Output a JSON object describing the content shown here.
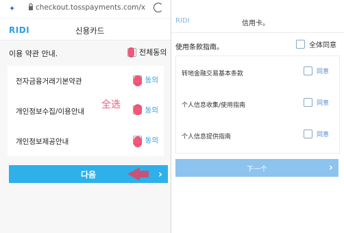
{
  "left": {
    "browser": {
      "url": "checkout.tosspayments.com/x"
    },
    "header": {
      "brand": "RIDI",
      "title": "신용카드"
    },
    "agreement_heading": "이용 약관 안내.",
    "agree_all_label": "전체동의",
    "items": [
      {
        "label": "전자금융거래기본약관",
        "agree": "동의"
      },
      {
        "label": "개인정보수집/이용안내",
        "agree": "동의"
      },
      {
        "label": "개인정보제공안내",
        "agree": "동의"
      }
    ],
    "annotation": "全选",
    "next_button": "다음",
    "mark_color": "#ee3c5e",
    "accent": "#2eb0ea"
  },
  "right": {
    "header": {
      "brand": "RIDI",
      "title": "信用卡。"
    },
    "agreement_heading": "使用条款指南。",
    "agree_all_label": "全体同意",
    "items": [
      {
        "label": "转地金融交易基本条款",
        "agree": "同意"
      },
      {
        "label": "个人信息收集/使用指南",
        "agree": "同意"
      },
      {
        "label": "个人信息提供指南",
        "agree": "同意"
      }
    ],
    "next_button": "下一个",
    "accent": "#8cc3ef"
  }
}
